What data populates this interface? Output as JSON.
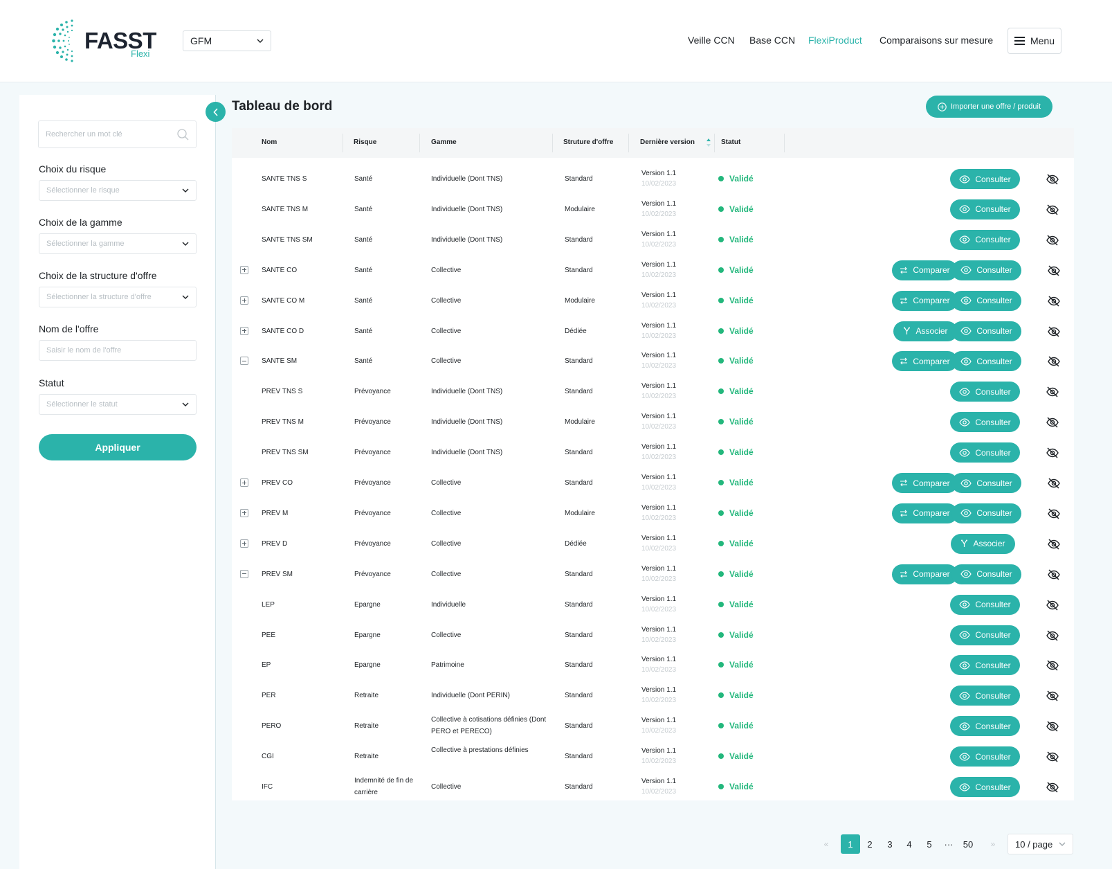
{
  "header": {
    "logo_text": "FASST",
    "logo_sub": "Flexi",
    "org_select": "GFM",
    "nav": [
      "Veille CCN",
      "Base CCN",
      "FlexiProduct",
      "Comparaisons sur mesure"
    ],
    "active_nav": "FlexiProduct",
    "menu_label": "Menu"
  },
  "sidebar": {
    "search_placeholder": "Rechercher un mot clé",
    "filters": [
      {
        "label": "Choix du risque",
        "placeholder": "Sélectionner le risque"
      },
      {
        "label": "Choix de la gamme",
        "placeholder": "Sélectionner la gamme"
      },
      {
        "label": "Choix de la structure d'offre",
        "placeholder": "Sélectionner la structure d'offre"
      },
      {
        "label": "Nom de l'offre",
        "placeholder": "Saisir le nom de l'offre"
      },
      {
        "label": "Statut",
        "placeholder": "Sélectionner le statut"
      }
    ],
    "apply_label": "Appliquer"
  },
  "main": {
    "title": "Tableau de bord",
    "import_label": "Importer une offre / produit",
    "columns": [
      "Nom",
      "Risque",
      "Gamme",
      "Struture d'offre",
      "Dernière version",
      "Statut"
    ],
    "labels": {
      "compare": "Comparer",
      "consult": "Consulter",
      "associate": "Associer"
    },
    "rows": [
      {
        "expander": "",
        "name": "SANTE TNS S",
        "risk": "Santé",
        "range": "Individuelle (Dont TNS)",
        "structure": "Standard",
        "version": "Version 1.1",
        "date": "10/02/2023",
        "status": "Validé",
        "actions": [
          "consult"
        ]
      },
      {
        "expander": "",
        "name": "SANTE TNS M",
        "risk": "Santé",
        "range": "Individuelle (Dont TNS)",
        "structure": "Modulaire",
        "version": "Version 1.1",
        "date": "10/02/2023",
        "status": "Validé",
        "actions": [
          "consult"
        ]
      },
      {
        "expander": "",
        "name": "SANTE TNS SM",
        "risk": "Santé",
        "range": "Individuelle (Dont TNS)",
        "structure": "Standard",
        "version": "Version 1.1",
        "date": "10/02/2023",
        "status": "Validé",
        "actions": [
          "consult"
        ]
      },
      {
        "expander": "plus",
        "name": "SANTE CO",
        "risk": "Santé",
        "range": "Collective",
        "structure": "Standard",
        "version": "Version 1.1",
        "date": "10/02/2023",
        "status": "Validé",
        "actions": [
          "compare",
          "consult"
        ]
      },
      {
        "expander": "plus",
        "name": "SANTE CO M",
        "risk": "Santé",
        "range": "Collective",
        "structure": "Modulaire",
        "version": "Version 1.1",
        "date": "10/02/2023",
        "status": "Validé",
        "actions": [
          "compare",
          "consult"
        ]
      },
      {
        "expander": "plus",
        "name": "SANTE CO D",
        "risk": "Santé",
        "range": "Collective",
        "structure": "Dédiée",
        "version": "Version 1.1",
        "date": "10/02/2023",
        "status": "Validé",
        "actions": [
          "associate",
          "consult"
        ]
      },
      {
        "expander": "minus",
        "name": "SANTE SM",
        "risk": "Santé",
        "range": "Collective",
        "structure": "Standard",
        "version": "Version 1.1",
        "date": "10/02/2023",
        "status": "Validé",
        "actions": [
          "compare",
          "consult"
        ]
      },
      {
        "expander": "",
        "name": "PREV TNS S",
        "risk": "Prévoyance",
        "range": "Individuelle (Dont TNS)",
        "structure": "Standard",
        "version": "Version 1.1",
        "date": "10/02/2023",
        "status": "Validé",
        "actions": [
          "consult"
        ]
      },
      {
        "expander": "",
        "name": "PREV TNS M",
        "risk": "Prévoyance",
        "range": "Individuelle (Dont TNS)",
        "structure": "Modulaire",
        "version": "Version 1.1",
        "date": "10/02/2023",
        "status": "Validé",
        "actions": [
          "consult"
        ]
      },
      {
        "expander": "",
        "name": "PREV TNS SM",
        "risk": "Prévoyance",
        "range": "Individuelle (Dont TNS)",
        "structure": "Standard",
        "version": "Version 1.1",
        "date": "10/02/2023",
        "status": "Validé",
        "actions": [
          "consult"
        ]
      },
      {
        "expander": "plus",
        "name": "PREV CO",
        "risk": "Prévoyance",
        "range": "Collective",
        "structure": "Standard",
        "version": "Version 1.1",
        "date": "10/02/2023",
        "status": "Validé",
        "actions": [
          "compare",
          "consult"
        ]
      },
      {
        "expander": "plus",
        "name": "PREV M",
        "risk": "Prévoyance",
        "range": "Collective",
        "structure": "Modulaire",
        "version": "Version 1.1",
        "date": "10/02/2023",
        "status": "Validé",
        "actions": [
          "compare",
          "consult"
        ]
      },
      {
        "expander": "plus",
        "name": "PREV D",
        "risk": "Prévoyance",
        "range": "Collective",
        "structure": "Dédiée",
        "version": "Version 1.1",
        "date": "10/02/2023",
        "status": "Validé",
        "actions": [
          "associate"
        ]
      },
      {
        "expander": "minus",
        "name": "PREV SM",
        "risk": "Prévoyance",
        "range": "Collective",
        "structure": "Standard",
        "version": "Version 1.1",
        "date": "10/02/2023",
        "status": "Validé",
        "actions": [
          "compare",
          "consult"
        ]
      },
      {
        "expander": "",
        "name": "LEP",
        "risk": "Epargne",
        "range": "Individuelle",
        "structure": "Standard",
        "version": "Version 1.1",
        "date": "10/02/2023",
        "status": "Validé",
        "actions": [
          "consult"
        ]
      },
      {
        "expander": "",
        "name": "PEE",
        "risk": "Epargne",
        "range": "Collective",
        "structure": "Standard",
        "version": "Version 1.1",
        "date": "10/02/2023",
        "status": "Validé",
        "actions": [
          "consult"
        ]
      },
      {
        "expander": "",
        "name": "EP",
        "risk": "Epargne",
        "range": "Patrimoine",
        "structure": "Standard",
        "version": "Version 1.1",
        "date": "10/02/2023",
        "status": "Validé",
        "actions": [
          "consult"
        ]
      },
      {
        "expander": "",
        "name": "PER",
        "risk": "Retraite",
        "range": "Individuelle (Dont PERIN)",
        "structure": "Standard",
        "version": "Version 1.1",
        "date": "10/02/2023",
        "status": "Validé",
        "actions": [
          "consult"
        ]
      },
      {
        "expander": "",
        "name": "PERO",
        "risk": "Retraite",
        "range": "Collective à cotisations définies (Dont PERO et PERECO)",
        "structure": "Standard",
        "version": "Version 1.1",
        "date": "10/02/2023",
        "status": "Validé",
        "actions": [
          "consult"
        ]
      },
      {
        "expander": "",
        "name": "CGI",
        "risk": "Retraite",
        "range": "Collective à prestations définies",
        "structure": "Standard",
        "version": "Version 1.1",
        "date": "10/02/2023",
        "status": "Validé",
        "actions": [
          "consult"
        ]
      },
      {
        "expander": "",
        "name": "IFC",
        "risk": "Indemnité de fin de carrière",
        "range": "Collective",
        "structure": "Standard",
        "version": "Version 1.1",
        "date": "10/02/2023",
        "status": "Validé",
        "actions": [
          "consult"
        ]
      }
    ]
  },
  "pagination": {
    "prev": "«",
    "pages": [
      "1",
      "2",
      "3",
      "4",
      "5"
    ],
    "ellipsis": "···",
    "last": "50",
    "next": "»",
    "current": "1",
    "page_size": "10 / page"
  },
  "colors": {
    "accent": "#2bb3aa",
    "status_valid": "#23b77c"
  },
  "icons": [
    "search-icon",
    "chevron-down-icon",
    "chevron-left-icon",
    "plus-circle-icon",
    "menu-icon",
    "eye-icon",
    "eye-off-icon",
    "compare-icon",
    "merge-icon",
    "sort-icon"
  ]
}
